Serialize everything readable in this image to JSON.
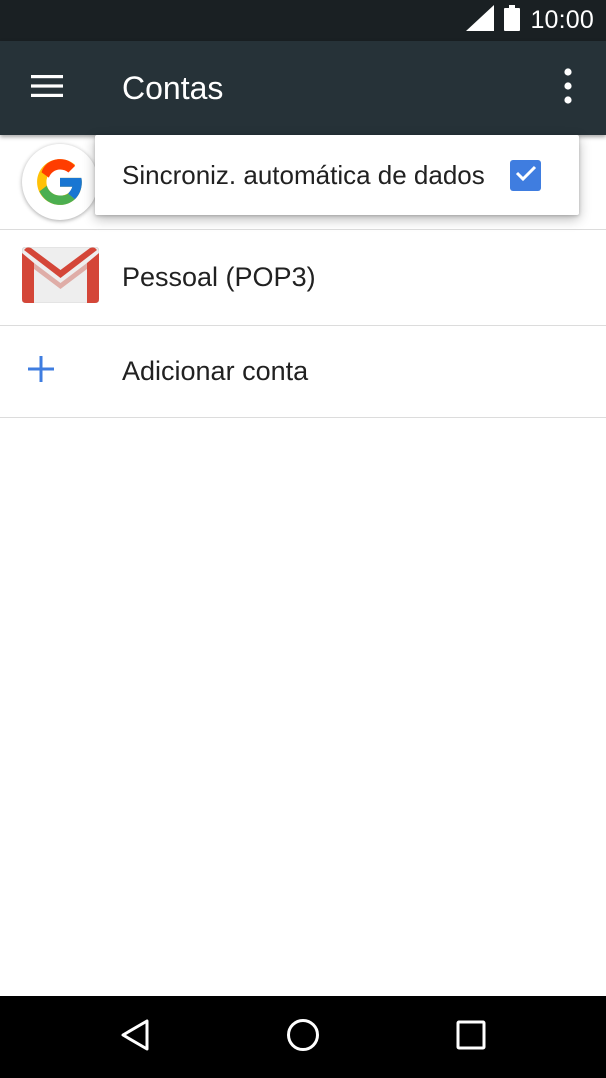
{
  "status_bar": {
    "time": "10:00",
    "icons": [
      "signal-icon",
      "battery-icon"
    ]
  },
  "app_bar": {
    "title": "Contas",
    "icons": [
      "menu-icon",
      "overflow-icon"
    ]
  },
  "accounts": [
    {
      "label": "",
      "icon": "google-icon"
    },
    {
      "label": "Pessoal (POP3)",
      "icon": "gmail-icon"
    },
    {
      "label": "Adicionar conta",
      "icon": "plus-icon"
    }
  ],
  "popup_menu": {
    "item_label": "Sincroniz. automática de dados",
    "checked": true
  },
  "nav_bar": {
    "icons": [
      "back-icon",
      "home-icon",
      "recents-icon"
    ]
  },
  "colors": {
    "status_bar": "#1a2023",
    "app_bar": "#263238",
    "checkbox": "#3f7de0",
    "plus": "#3f7de0",
    "gmail_red": "#d44638"
  }
}
